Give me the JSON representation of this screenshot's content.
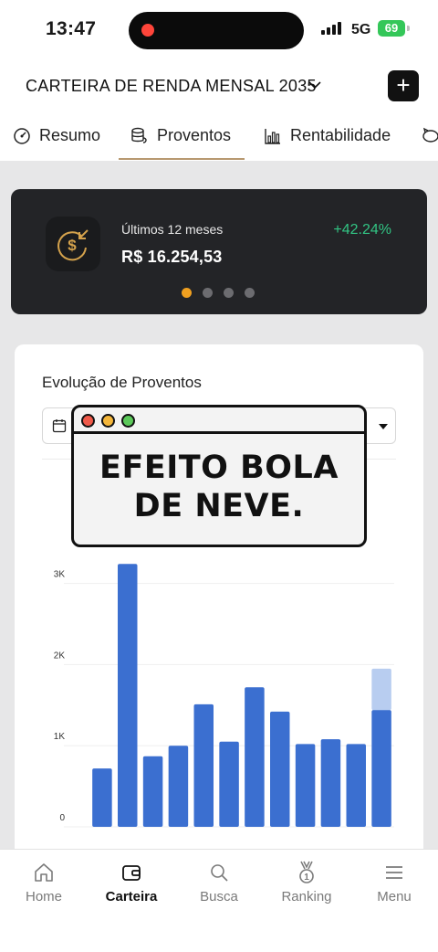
{
  "status_bar": {
    "time": "13:47",
    "network": "5G",
    "battery": "69"
  },
  "header": {
    "portfolio_name": "CARTEIRA DE RENDA MENSAL 2035",
    "add_label": "+"
  },
  "tabs": [
    {
      "label": "Resumo",
      "icon": "gauge-icon"
    },
    {
      "label": "Proventos",
      "icon": "coins-icon",
      "active": true
    },
    {
      "label": "Rentabilidade",
      "icon": "bar-chart-icon"
    }
  ],
  "summary": {
    "label": "Últimos 12 meses",
    "value": "R$ 16.254,53",
    "change": "+42.24%",
    "change_color": "#32c584",
    "pages": 4,
    "active_page": 0
  },
  "overlay": {
    "line1": "EFEITO BOLA",
    "line2": "DE NEVE."
  },
  "chart_card": {
    "title": "Evolução de Proventos"
  },
  "chart_data": {
    "type": "bar",
    "title": "",
    "xlabel": "",
    "ylabel": "",
    "ylim": [
      0,
      3200
    ],
    "yticks": [
      0,
      1000,
      2000,
      3000
    ],
    "ytick_labels": [
      "0",
      "1K",
      "2K",
      "3K"
    ],
    "grid": true,
    "series": [
      {
        "values": [
          720,
          3240,
          870,
          1000,
          1510,
          1050,
          1720,
          1420,
          1020,
          1080,
          1020,
          1440
        ],
        "color": "#3b6fd0"
      },
      {
        "values": [
          0,
          0,
          0,
          0,
          0,
          0,
          0,
          0,
          0,
          0,
          0,
          510
        ],
        "color": "#b8cdf0"
      }
    ]
  },
  "bottom_nav": [
    {
      "label": "Home",
      "icon": "home-icon"
    },
    {
      "label": "Carteira",
      "icon": "wallet-icon",
      "active": true
    },
    {
      "label": "Busca",
      "icon": "search-icon"
    },
    {
      "label": "Ranking",
      "icon": "medal-icon"
    },
    {
      "label": "Menu",
      "icon": "menu-icon"
    }
  ]
}
